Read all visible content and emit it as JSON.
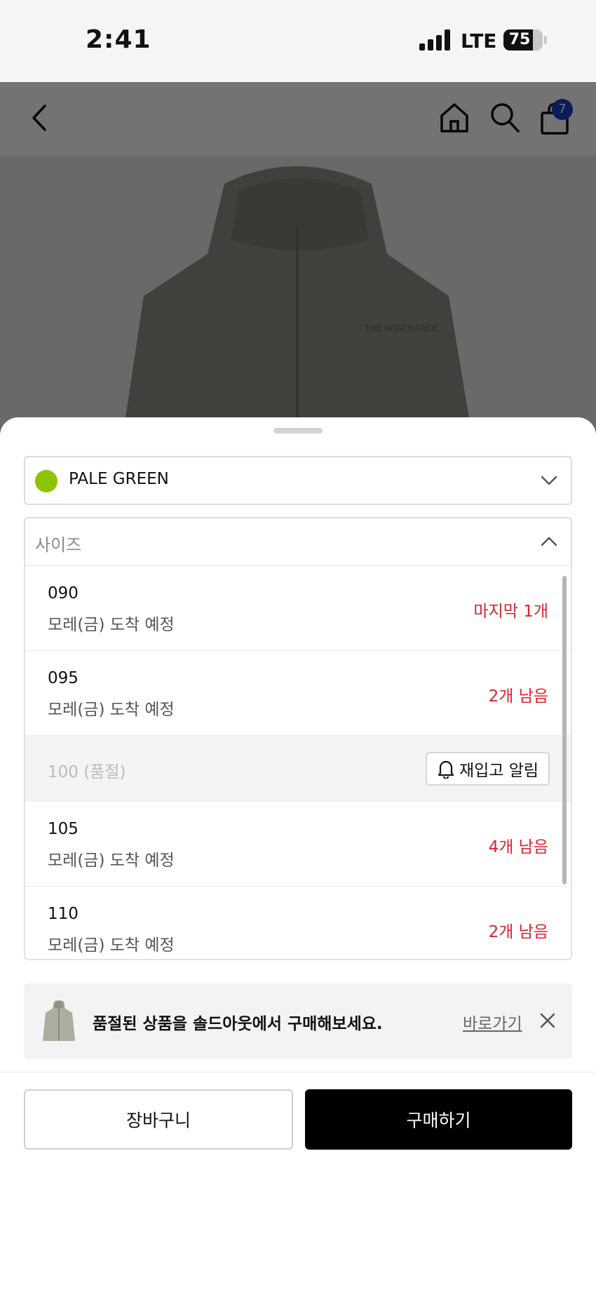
{
  "status_bar": {
    "time": "2:41",
    "network": "LTE",
    "battery_level": "75",
    "battery_fraction": 0.75
  },
  "header": {
    "cart_count": "7",
    "icons": [
      "back-icon",
      "home-icon",
      "search-icon",
      "shopping-bag-icon"
    ]
  },
  "color_option": {
    "name": "PALE GREEN",
    "swatch": "#8cc400"
  },
  "size_option": {
    "label": "사이즈",
    "items": [
      {
        "size": "090",
        "arrival": "모레(금) 도착 예정",
        "stock": "마지막 1개"
      },
      {
        "size": "095",
        "arrival": "모레(금) 도착 예정",
        "stock": "2개 남음"
      },
      {
        "sold_out_label": "100 (품절)",
        "restock_button": "재입고 알림"
      },
      {
        "size": "105",
        "arrival": "모레(금) 도착 예정",
        "stock": "4개 남음"
      },
      {
        "size": "110",
        "arrival": "모레(금) 도착 예정",
        "stock": "2개 남음"
      }
    ]
  },
  "promo": {
    "text": "품절된 상품을 솔드아웃에서 구매해보세요.",
    "link": "바로가기"
  },
  "actions": {
    "cart": "장바구니",
    "buy": "구매하기"
  },
  "colors": {
    "accent": "#000000",
    "stock_warning": "#d8242f",
    "badge": "#1742c4"
  }
}
